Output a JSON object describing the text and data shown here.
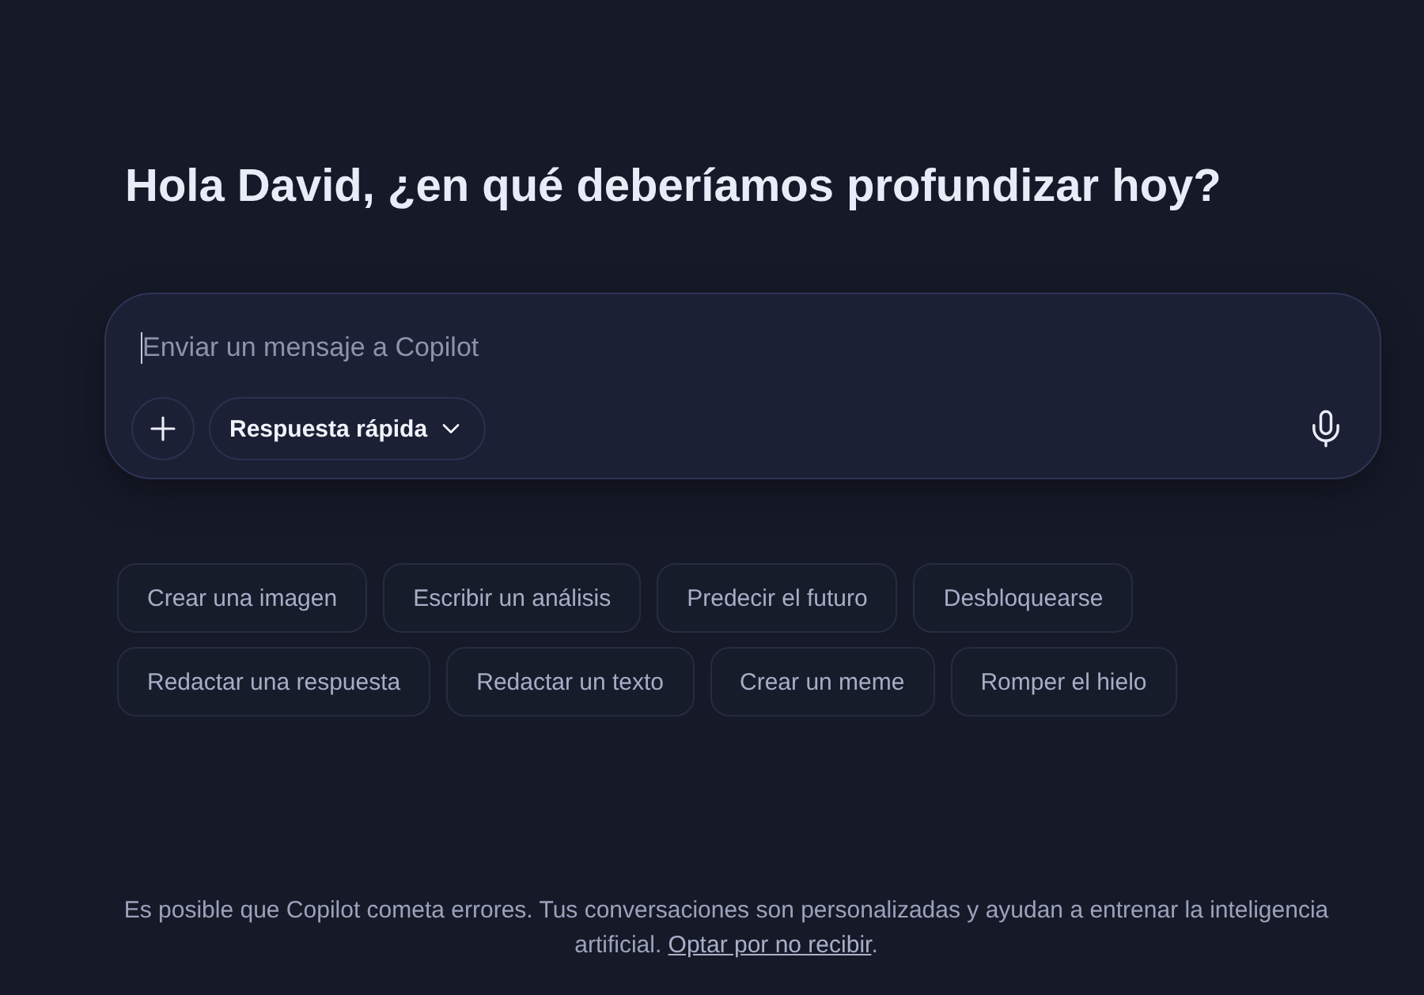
{
  "heading": "Hola David, ¿en qué deberíamos profundizar hoy?",
  "composer": {
    "placeholder": "Enviar un mensaje a Copilot",
    "mode_button": "Respuesta rápida"
  },
  "suggestions": [
    {
      "label": "Crear una imagen"
    },
    {
      "label": "Escribir un análisis"
    },
    {
      "label": "Predecir el futuro"
    },
    {
      "label": "Desbloquearse"
    },
    {
      "label": "Redactar una respuesta"
    },
    {
      "label": "Redactar un texto"
    },
    {
      "label": "Crear un meme"
    },
    {
      "label": "Romper el hielo"
    }
  ],
  "footer": {
    "text": "Es posible que Copilot cometa errores. Tus conversaciones son personalizadas y ayudan a entrenar la inteligencia artificial. ",
    "link": "Optar por no recibir",
    "suffix": "."
  }
}
